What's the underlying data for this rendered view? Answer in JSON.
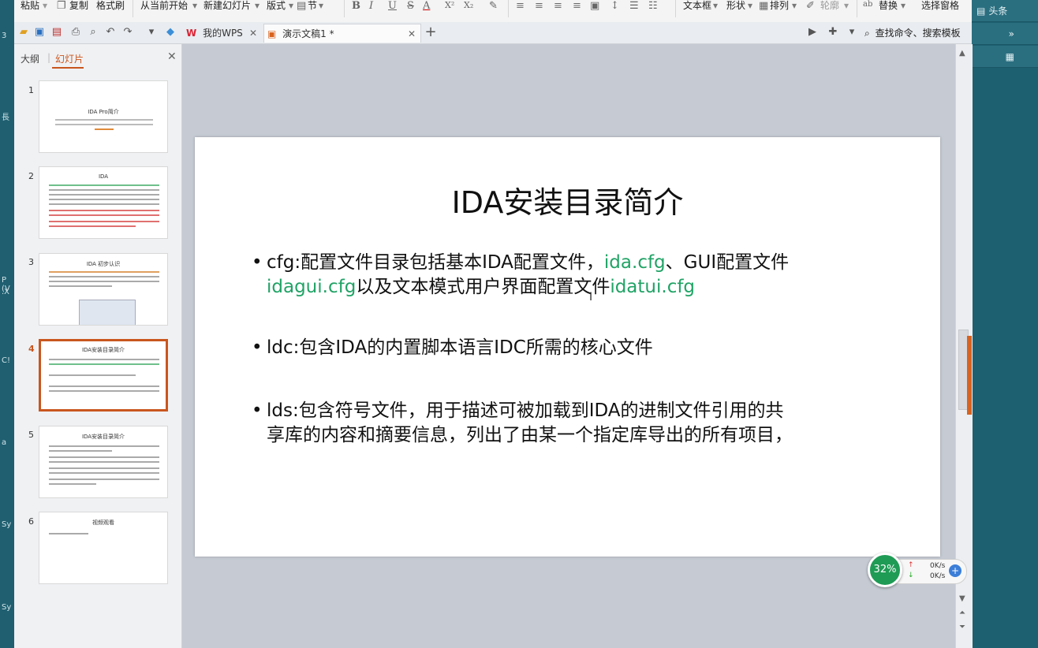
{
  "ribbon": {
    "paste": "粘贴",
    "copy": "复制",
    "format_painter": "格式刷",
    "from_current": "从当前开始",
    "new_slide": "新建幻灯片",
    "layout": "版式",
    "section": "节",
    "textbox": "文本框",
    "shape": "形状",
    "arrange": "排列",
    "outline": "轮廓",
    "replace": "替换",
    "select_pane": "选择窗格",
    "font_buttons": [
      "B",
      "I",
      "U",
      "S",
      "A",
      "X²",
      "X₂"
    ]
  },
  "tabs": {
    "my_wps": "我的WPS",
    "document": "演示文稿1 *"
  },
  "search": {
    "label": "查找命令、搜索模板"
  },
  "panel": {
    "outline_tab": "大纲",
    "slides_tab": "幻灯片",
    "thumbnails": [
      {
        "num": "1",
        "title": "IDA Pro简介",
        "active": false
      },
      {
        "num": "2",
        "title": "IDA",
        "active": false
      },
      {
        "num": "3",
        "title": "IDA 初步认识",
        "active": false
      },
      {
        "num": "4",
        "title": "IDA安装目录简介",
        "active": true
      },
      {
        "num": "5",
        "title": "IDA安装目录简介",
        "active": false
      },
      {
        "num": "6",
        "title": "视频观看",
        "active": false
      }
    ]
  },
  "slide": {
    "title": "IDA安装目录简介",
    "bullets": [
      {
        "parts": [
          {
            "text": "cfg:配置文件目录包括基本IDA配置文件，",
            "green": false
          },
          {
            "text": "ida.cfg",
            "green": true
          },
          {
            "text": "、GUI配置文件",
            "green": false
          }
        ],
        "line2": [
          {
            "text": "idagui.cfg",
            "green": true
          },
          {
            "text": "以及文本模式用户界面配置文件",
            "green": false
          },
          {
            "text": "idatui.cfg",
            "green": true
          }
        ]
      },
      {
        "parts": [
          {
            "text": "ldc:包含IDA的内置脚本语言IDC所需的核心文件",
            "green": false
          }
        ]
      },
      {
        "parts": [
          {
            "text": "lds:包含符号文件，用于描述可被加载到IDA的进制文件引用的共",
            "green": false
          }
        ],
        "line2": [
          {
            "text": "享库的内容和摘要信息，列出了由某一个指定库导出的所有项目，",
            "green": false
          }
        ]
      }
    ]
  },
  "network": {
    "percent": "32%",
    "up": "0K/s",
    "down": "0K/s"
  },
  "desktop_right": {
    "tile1": "头条"
  },
  "colors": {
    "accent": "#c9561e",
    "green_text": "#21a366",
    "net_green": "#1f9b55"
  }
}
